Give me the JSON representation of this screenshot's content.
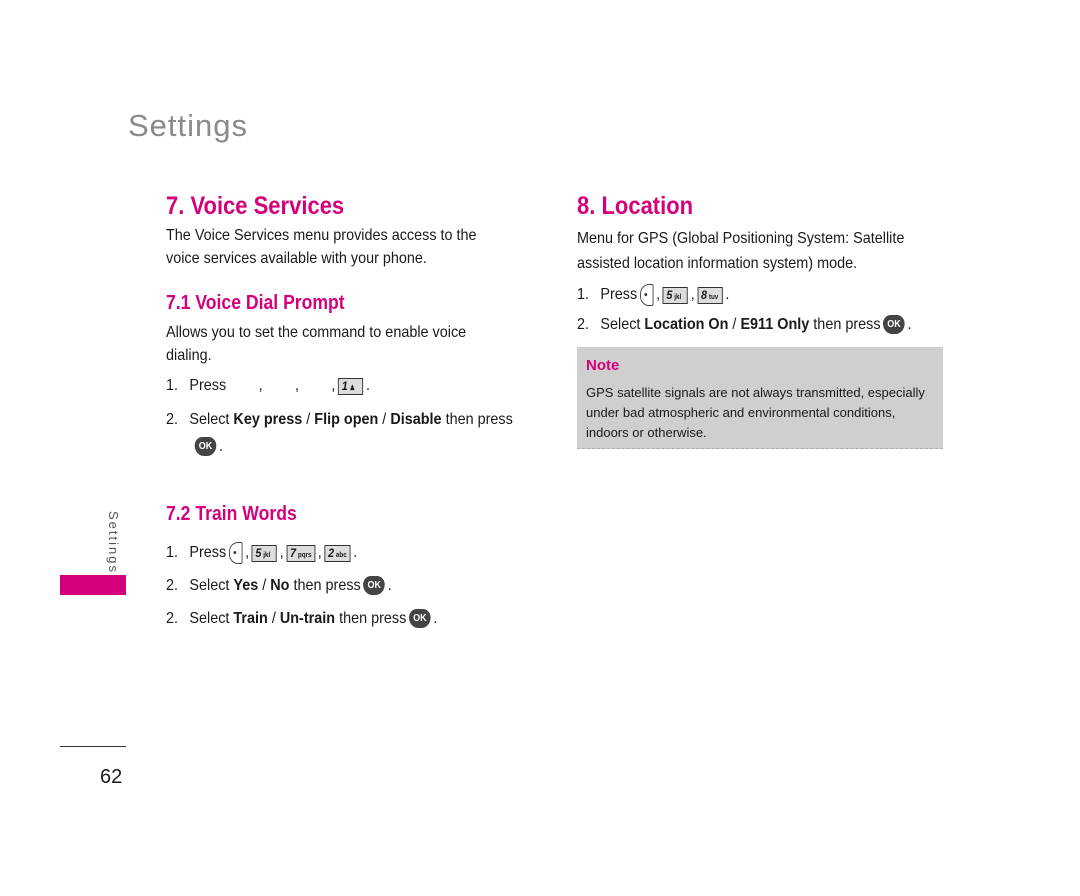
{
  "header": {
    "title": "Settings"
  },
  "side": {
    "label": "Settings",
    "page_number": "62",
    "accent": "#d4007c"
  },
  "voice": {
    "heading": "7. Voice Services",
    "intro": [
      "The Voice Services menu provides access to the",
      "voice services available with your phone."
    ],
    "dial": {
      "heading": "7.1 Voice Dial Prompt",
      "intro": [
        "Allows you to set the command to enable voice",
        "dialing."
      ],
      "s1": {
        "num": "1.",
        "press": "Press",
        "key1": "1"
      },
      "s2": {
        "num": "2.",
        "pre": "Select",
        "b1": "Key press",
        "sep": "/",
        "b2": "Flip open",
        "b3": "Disable",
        "post": "then press"
      }
    },
    "train": {
      "heading": "7.2 Train Words",
      "s1": {
        "num": "1.",
        "press": "Press",
        "k1": "5",
        "k1s": "jkl",
        "k2": "7",
        "k2s": "pqrs",
        "k3": "2",
        "k3s": "abc"
      },
      "s2": {
        "num": "2.",
        "pre": "Select",
        "b1": "Yes",
        "sep": "/",
        "b2": "No",
        "post": "then press"
      },
      "s3": {
        "num": "2.",
        "pre": "Select",
        "b1": "Train",
        "sep": "/",
        "b2": "Un-train",
        "post": "then press"
      }
    }
  },
  "location": {
    "heading": "8. Location",
    "intro": [
      "Menu for GPS (Global Positioning System: Satellite",
      "assisted location information system) mode."
    ],
    "s1": {
      "num": "1.",
      "press": "Press",
      "k1": "5",
      "k1s": "jkl",
      "k2": "8",
      "k2s": "tuv"
    },
    "s2": {
      "num": "2.",
      "pre": "Select",
      "b1": "Location On",
      "sep": "/",
      "b2": "E911 Only",
      "post": "then press"
    },
    "note": {
      "title": "Note",
      "lines": [
        "GPS satellite signals are not always transmitted, especially",
        "under bad atmospheric and environmental conditions,",
        "indoors or otherwise."
      ]
    }
  },
  "ok_label": "OK"
}
